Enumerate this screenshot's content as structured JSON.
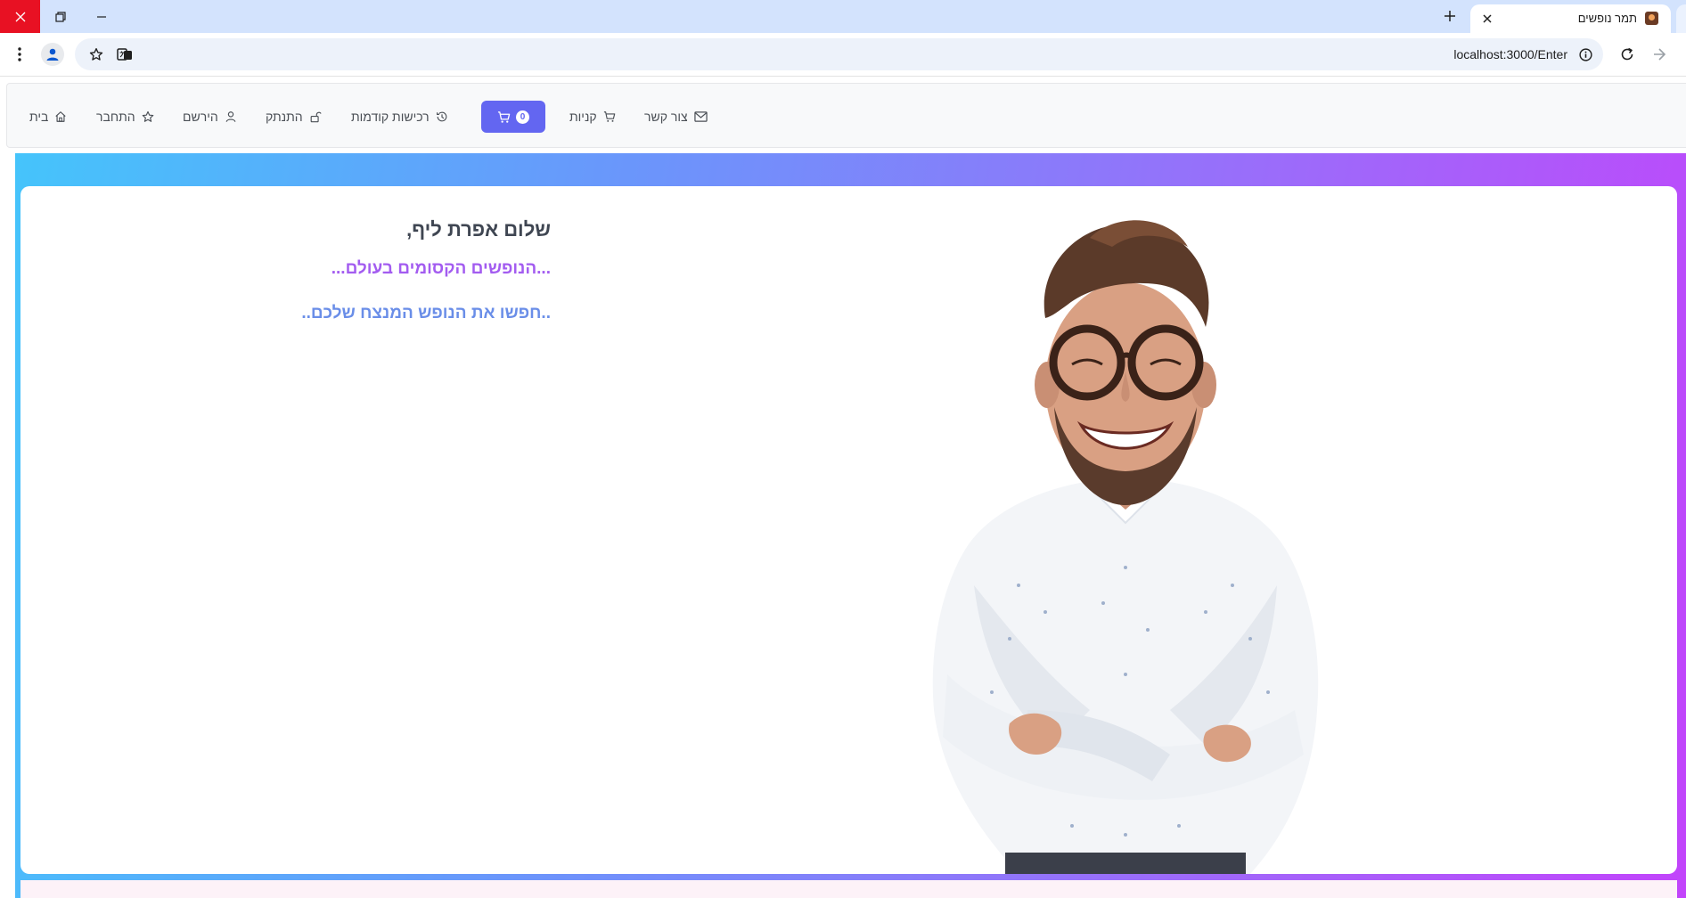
{
  "browser": {
    "tab_title": "תמר נופשים",
    "url": "localhost:3000/Enter"
  },
  "navbar": {
    "items": [
      {
        "label": "בית",
        "icon": "home-icon"
      },
      {
        "label": "התחבר",
        "icon": "star-icon"
      },
      {
        "label": "הירשם",
        "icon": "user-icon"
      },
      {
        "label": "התנתק",
        "icon": "unlock-icon"
      },
      {
        "label": "רכישות קודמות",
        "icon": "history-icon"
      },
      {
        "label": "קניות",
        "icon": "cart-icon"
      },
      {
        "label": "צור קשר",
        "icon": "mail-icon"
      }
    ],
    "cart": {
      "count": "0",
      "icon": "cart-icon",
      "color": "#6366f1"
    }
  },
  "hero": {
    "greeting": "שלום אפרת ליף,",
    "tagline": "...הנופשים הקסומים בעולם...",
    "cta": "..חפשו את הנופש המנצח שלכם..",
    "image": "smiling-man-with-glasses",
    "gradient": [
      "#45c4fb",
      "#c244fb"
    ]
  }
}
